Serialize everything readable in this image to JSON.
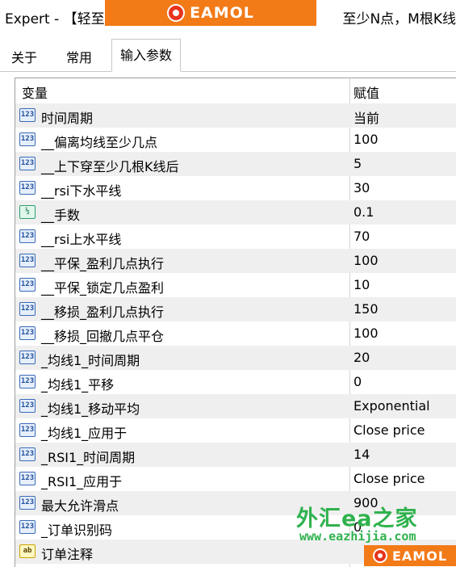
{
  "window": {
    "title_left": "Expert - 【轻至",
    "title_right": "至少N点，M根K线"
  },
  "brand": {
    "logo_text": "EAMOL",
    "watermark_zh": "外汇ea之家",
    "watermark_url": "www.eazhijia.com"
  },
  "tabs": [
    {
      "label": "关于"
    },
    {
      "label": "常用"
    },
    {
      "label": "输入参数"
    }
  ],
  "table": {
    "headers": {
      "variable": "变量",
      "value": "赋值"
    },
    "rows": [
      {
        "icon": "123",
        "name": "时间周期",
        "value": "当前"
      },
      {
        "icon": "123",
        "name": "__偏离均线至少几点",
        "value": "100"
      },
      {
        "icon": "123",
        "name": "__上下穿至少几根K线后",
        "value": "5"
      },
      {
        "icon": "123",
        "name": "__rsi下水平线",
        "value": "30"
      },
      {
        "icon": "½",
        "name": "__手数",
        "value": "0.1"
      },
      {
        "icon": "123",
        "name": "__rsi上水平线",
        "value": "70"
      },
      {
        "icon": "123",
        "name": "__平保_盈利几点执行",
        "value": "100"
      },
      {
        "icon": "123",
        "name": "__平保_锁定几点盈利",
        "value": "10"
      },
      {
        "icon": "123",
        "name": "__移损_盈利几点执行",
        "value": "150"
      },
      {
        "icon": "123",
        "name": "__移损_回撤几点平仓",
        "value": "100"
      },
      {
        "icon": "123",
        "name": "_均线1_时间周期",
        "value": "20"
      },
      {
        "icon": "123",
        "name": "_均线1_平移",
        "value": "0"
      },
      {
        "icon": "123",
        "name": "_均线1_移动平均",
        "value": "Exponential"
      },
      {
        "icon": "123",
        "name": "_均线1_应用于",
        "value": "Close price"
      },
      {
        "icon": "123",
        "name": "_RSI1_时间周期",
        "value": "14"
      },
      {
        "icon": "123",
        "name": "_RSI1_应用于",
        "value": "Close price"
      },
      {
        "icon": "123",
        "name": "最大允许滑点",
        "value": "900"
      },
      {
        "icon": "123",
        "name": "_订单识别码",
        "value": "0"
      },
      {
        "icon": "ab",
        "name": "订单注释",
        "value": ""
      }
    ]
  }
}
